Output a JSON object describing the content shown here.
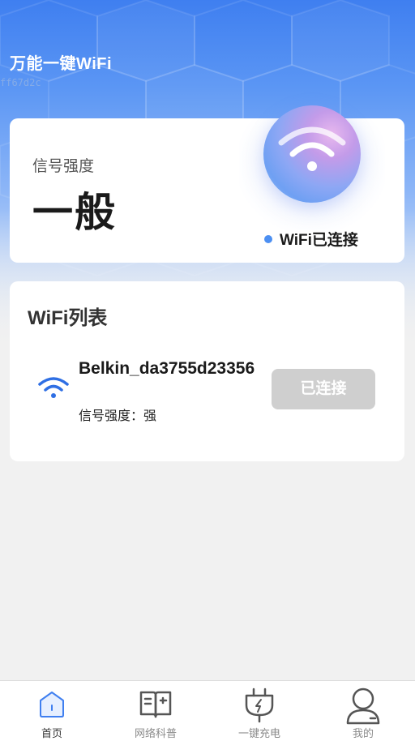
{
  "header": {
    "app_title": "万能一键WiFi",
    "debug_id": "ff67d2c"
  },
  "signal_card": {
    "label": "信号强度",
    "value": "一般",
    "status_text": "WiFi已连接"
  },
  "wifi_list": {
    "title": "WiFi列表",
    "items": [
      {
        "ssid": "Belkin_da3755d23356",
        "strength": "信号强度：强",
        "button_label": "已连接"
      }
    ]
  },
  "bottom_nav": {
    "items": [
      {
        "label": "首页",
        "icon": "home-icon",
        "active": true
      },
      {
        "label": "网络科普",
        "icon": "book-icon",
        "active": false
      },
      {
        "label": "一键充电",
        "icon": "charger-icon",
        "active": false
      },
      {
        "label": "我的",
        "icon": "user-icon",
        "active": false
      }
    ]
  },
  "colors": {
    "accent": "#4c8ff2",
    "hero_top": "#3f7ff0",
    "button_disabled": "#cfcfcf"
  }
}
